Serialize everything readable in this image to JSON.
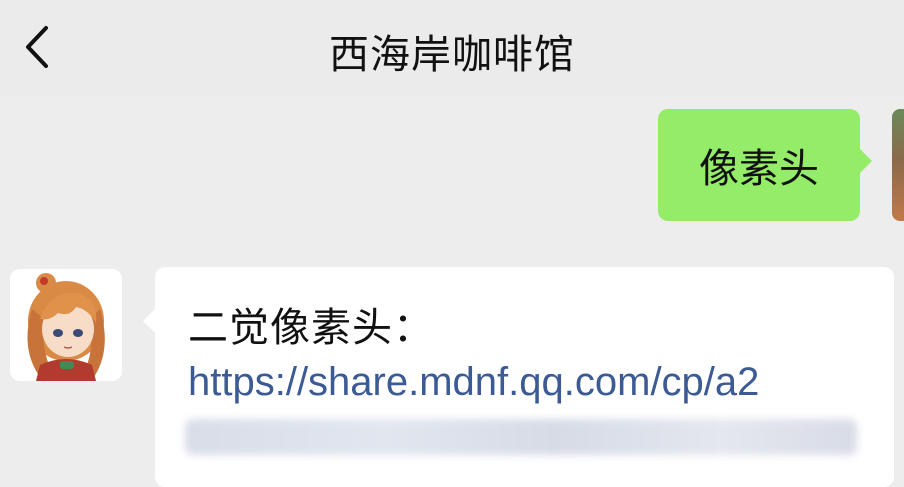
{
  "header": {
    "back_icon": "chevron-left-icon",
    "title": "西海岸咖啡馆"
  },
  "messages": [
    {
      "direction": "outgoing",
      "text": "像素头",
      "bubble_color": "#95ec69"
    },
    {
      "direction": "incoming",
      "text": "二觉像素头：",
      "link": "https://share.mdnf.qq.com/cp/a2",
      "link_color": "#3c5a94"
    }
  ],
  "colors": {
    "background": "#ededed",
    "incoming_bubble": "#ffffff",
    "outgoing_bubble": "#95ec69"
  }
}
